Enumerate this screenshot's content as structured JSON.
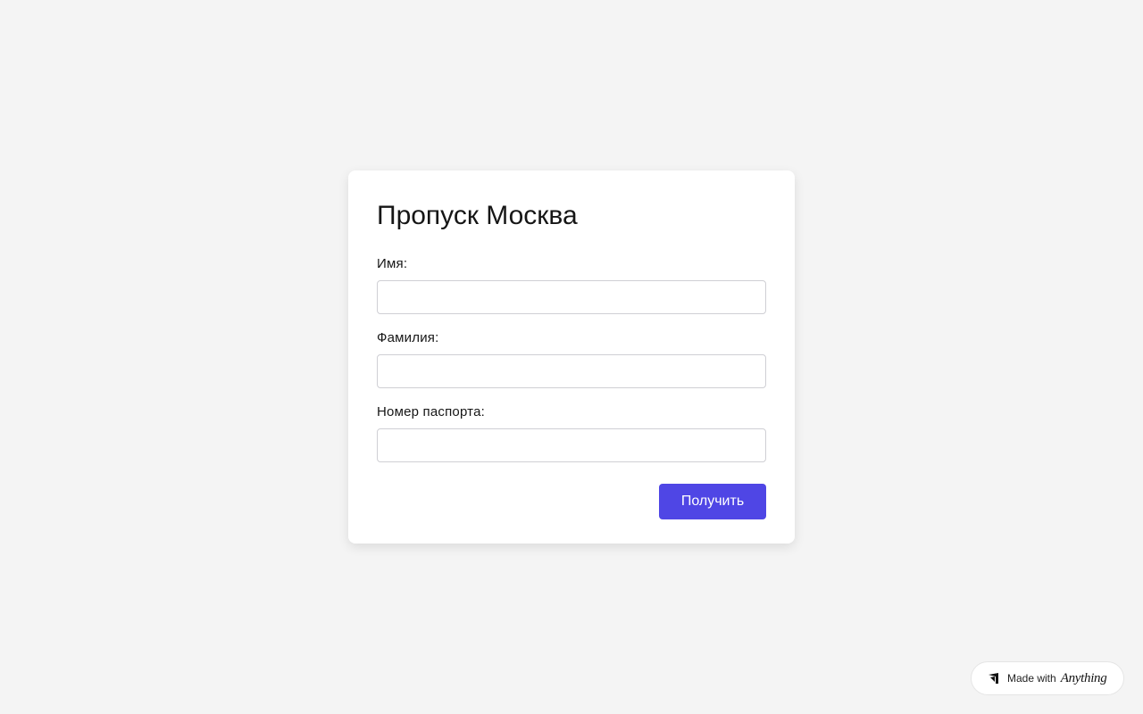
{
  "form": {
    "title": "Пропуск Москва",
    "fields": [
      {
        "label": "Имя:",
        "value": "",
        "placeholder": ""
      },
      {
        "label": "Фамилия:",
        "value": "",
        "placeholder": ""
      },
      {
        "label": "Номер паспорта:",
        "value": "",
        "placeholder": ""
      }
    ],
    "submit_label": "Получить",
    "accent_color": "#4f46e5"
  },
  "badge": {
    "made_with": "Made with",
    "brand": "Anything",
    "icon": "anything-logo-icon"
  }
}
